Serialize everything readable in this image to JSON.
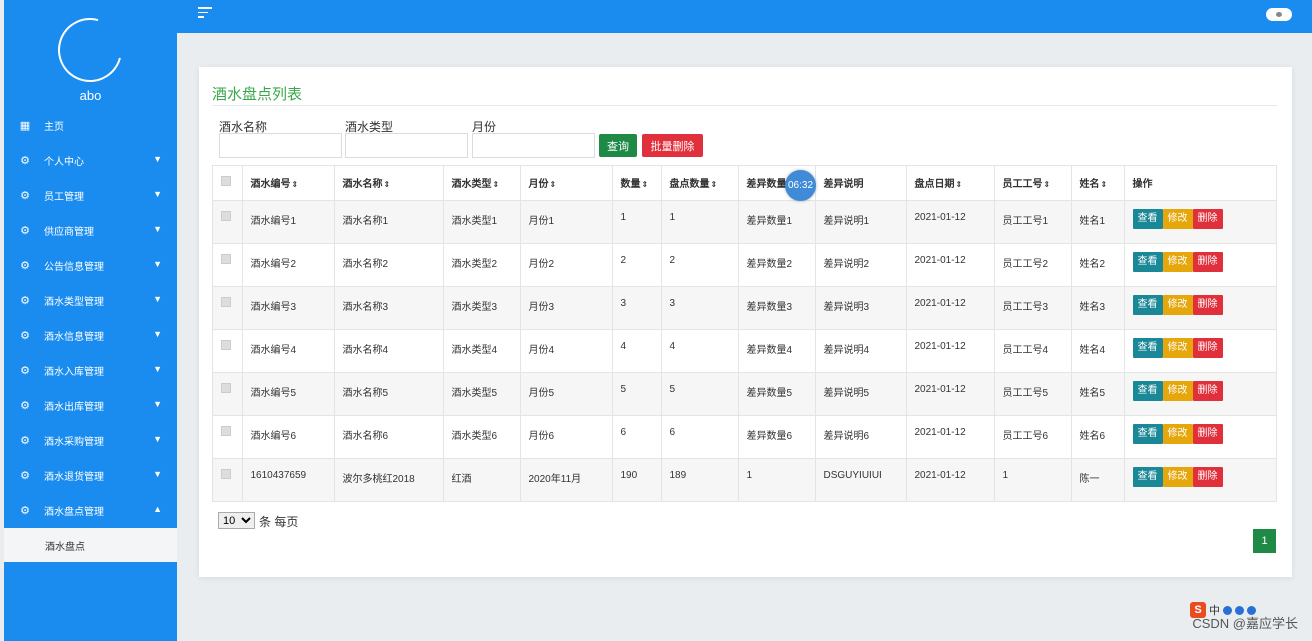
{
  "sidebar": {
    "username": "abo",
    "items": [
      {
        "label": "主页",
        "icon": "grid-icon",
        "has_caret": false
      },
      {
        "label": "个人中心",
        "icon": "gear-icon",
        "has_caret": true
      },
      {
        "label": "员工管理",
        "icon": "gear-icon",
        "has_caret": true
      },
      {
        "label": "供应商管理",
        "icon": "gear-icon",
        "has_caret": true
      },
      {
        "label": "公告信息管理",
        "icon": "gear-icon",
        "has_caret": true
      },
      {
        "label": "酒水类型管理",
        "icon": "gear-icon",
        "has_caret": true
      },
      {
        "label": "酒水信息管理",
        "icon": "gear-icon",
        "has_caret": true
      },
      {
        "label": "酒水入库管理",
        "icon": "gear-icon",
        "has_caret": true
      },
      {
        "label": "酒水出库管理",
        "icon": "gear-icon",
        "has_caret": true
      },
      {
        "label": "酒水采购管理",
        "icon": "gear-icon",
        "has_caret": true
      },
      {
        "label": "酒水退货管理",
        "icon": "gear-icon",
        "has_caret": true
      },
      {
        "label": "酒水盘点管理",
        "icon": "gear-icon",
        "has_caret": true,
        "expanded": true
      }
    ],
    "submenu": {
      "label": "酒水盘点"
    }
  },
  "page": {
    "title": "酒水盘点列表"
  },
  "filters": {
    "name_label": "酒水名称",
    "type_label": "酒水类型",
    "month_label": "月份",
    "name_value": "",
    "type_value": "",
    "month_value": "",
    "search_label": "查询",
    "batch_delete_label": "批量删除"
  },
  "table": {
    "columns": [
      "酒水编号",
      "酒水名称",
      "酒水类型",
      "月份",
      "数量",
      "盘点数量",
      "差异数量",
      "差异说明",
      "盘点日期",
      "员工工号",
      "姓名",
      "操作"
    ],
    "sortable": [
      true,
      true,
      true,
      true,
      true,
      true,
      false,
      false,
      true,
      true,
      true,
      false
    ],
    "rows": [
      [
        "酒水编号1",
        "酒水名称1",
        "酒水类型1",
        "月份1",
        "1",
        "1",
        "差异数量1",
        "差异说明1",
        "2021-01-12",
        "员工工号1",
        "姓名1"
      ],
      [
        "酒水编号2",
        "酒水名称2",
        "酒水类型2",
        "月份2",
        "2",
        "2",
        "差异数量2",
        "差异说明2",
        "2021-01-12",
        "员工工号2",
        "姓名2"
      ],
      [
        "酒水编号3",
        "酒水名称3",
        "酒水类型3",
        "月份3",
        "3",
        "3",
        "差异数量3",
        "差异说明3",
        "2021-01-12",
        "员工工号3",
        "姓名3"
      ],
      [
        "酒水编号4",
        "酒水名称4",
        "酒水类型4",
        "月份4",
        "4",
        "4",
        "差异数量4",
        "差异说明4",
        "2021-01-12",
        "员工工号4",
        "姓名4"
      ],
      [
        "酒水编号5",
        "酒水名称5",
        "酒水类型5",
        "月份5",
        "5",
        "5",
        "差异数量5",
        "差异说明5",
        "2021-01-12",
        "员工工号5",
        "姓名5"
      ],
      [
        "酒水编号6",
        "酒水名称6",
        "酒水类型6",
        "月份6",
        "6",
        "6",
        "差异数量6",
        "差异说明6",
        "2021-01-12",
        "员工工号6",
        "姓名6"
      ],
      [
        "1610437659",
        "波尔多桃红2018",
        "红酒",
        "2020年11月",
        "190",
        "189",
        "1",
        "DSGUYIUIUI",
        "2021-01-12",
        "1",
        "陈一"
      ]
    ],
    "actions": {
      "view": "查看",
      "edit": "修改",
      "delete": "删除"
    }
  },
  "timer": "06:32",
  "pagination": {
    "page_size": "10",
    "page_size_suffix": "条 每页",
    "current_page": "1"
  },
  "watermark": "CSDN @嘉应学长",
  "ime": {
    "logo": "S",
    "lang": "中"
  },
  "colors": {
    "primary_blue": "#1a8cf0",
    "title_green": "#39a84a",
    "search_green": "#1e8a45",
    "delete_red": "#e0303c",
    "view_teal": "#1b8897",
    "edit_amber": "#e6a70d"
  }
}
